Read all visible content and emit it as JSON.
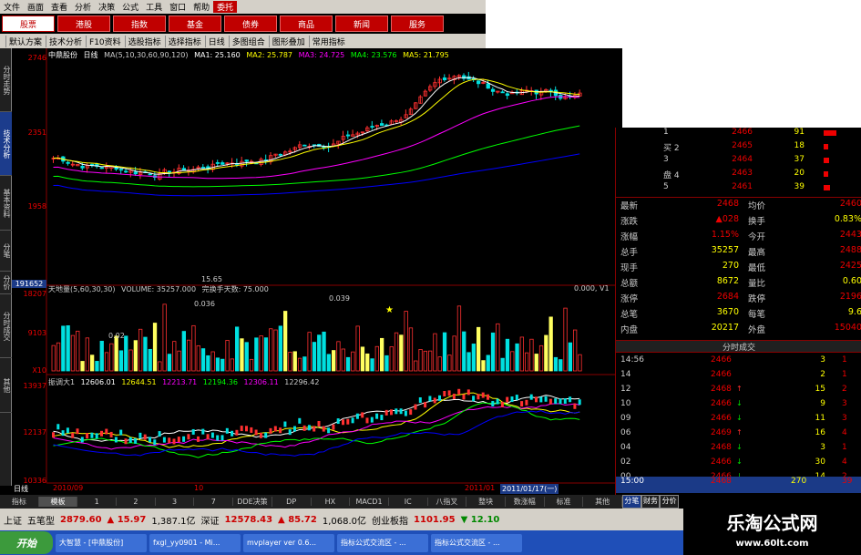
{
  "menu": [
    "文件",
    "画面",
    "查看",
    "分析",
    "决策",
    "公式",
    "工具",
    "窗口",
    "帮助",
    "委托"
  ],
  "nav": [
    "股票",
    "港股",
    "指数",
    "基金",
    "债券",
    "商品",
    "新闻",
    "服务"
  ],
  "toolbar": [
    "默认方案",
    "技术分析",
    "F10资料",
    "选股指标",
    "选择指标",
    "日线",
    "多图组合",
    "图形叠加",
    "常用指标"
  ],
  "sidetabs": [
    "分时走势",
    "技术分析",
    "基本资料",
    "分笔",
    "分价",
    "分时成交",
    "其他"
  ],
  "main_axis": {
    "top": "2746",
    "upper": "2351",
    "lower": "1958",
    "box": "191652"
  },
  "ma_legend": {
    "stock": "中鼎股份",
    "period": "日线",
    "params": "MA(5,10,30,60,90,120)",
    "ma1": "MA1: 25.160",
    "ma2": "MA2: 25.787",
    "ma3": "MA3: 24.725",
    "ma4": "MA4: 23.576",
    "ma5": "MA5: 21.795"
  },
  "min_label": "15.65",
  "vol_axis": {
    "top": "18207",
    "mid": "9103",
    "unit": "X10"
  },
  "vol_legend": {
    "name": "天地量(5,60,30,30)",
    "volume": "VOLUME: 35257.000",
    "days": "完换手天数: 75.000",
    "right": "0.000, V1"
  },
  "vol_marks": {
    "a": "0.039",
    "b": "0.036",
    "c": "0.02"
  },
  "ind_axis": {
    "top": "13937",
    "mid": "12137",
    "bottom": "10336"
  },
  "ind_legend": {
    "name": "振调大1",
    "v1": "12606.01",
    "v2": "12644.51",
    "v3": "12213.71",
    "v4": "12194.36",
    "v5": "12306.11",
    "v6": "12296.42"
  },
  "date_bar": {
    "period": "日线",
    "d1": "2010/09",
    "d2": "10",
    "d3": "2011/01",
    "cursor": "2011/01/17(一)"
  },
  "orderbook": [
    {
      "label": "1",
      "price": "2466",
      "vol": "91",
      "bar": 0.45
    },
    {
      "label": "买 2",
      "price": "2465",
      "vol": "18",
      "bar": 0.18
    },
    {
      "label": "3",
      "price": "2464",
      "vol": "37",
      "bar": 0.2
    },
    {
      "label": "盘 4",
      "price": "2463",
      "vol": "20",
      "bar": 0.18
    },
    {
      "label": "5",
      "price": "2461",
      "vol": "39",
      "bar": 0.22
    }
  ],
  "stats": [
    {
      "k": "最新",
      "v": "2468",
      "k2": "均价",
      "v2": "2460"
    },
    {
      "k": "涨跌",
      "v": "▲028",
      "k2": "换手",
      "v2": "0.83%"
    },
    {
      "k": "涨幅",
      "v": "1.15%",
      "k2": "今开",
      "v2": "2443"
    },
    {
      "k": "总手",
      "v": "35257",
      "k2": "最高",
      "v2": "2488"
    },
    {
      "k": "现手",
      "v": "270",
      "k2": "最低",
      "v2": "2425"
    },
    {
      "k": "总额",
      "v": "8672",
      "k2": "量比",
      "v2": "0.60"
    },
    {
      "k": "涨停",
      "v": "2684",
      "k2": "跌停",
      "v2": "2196"
    },
    {
      "k": "总笔",
      "v": "3670",
      "k2": "每笔",
      "v2": "9.6"
    },
    {
      "k": "内盘",
      "v": "20217",
      "k2": "外盘",
      "v2": "15040"
    }
  ],
  "trades_title": "分时成交",
  "trades": [
    {
      "t": "14:56",
      "p": "2466",
      "a": "",
      "v": "3",
      "n": "1"
    },
    {
      "t": "14",
      "p": "2466",
      "a": "",
      "v": "2",
      "n": "1"
    },
    {
      "t": "12",
      "p": "2468",
      "a": "↑",
      "v": "15",
      "n": "2"
    },
    {
      "t": "10",
      "p": "2466",
      "a": "↓",
      "v": "9",
      "n": "3"
    },
    {
      "t": "09",
      "p": "2466",
      "a": "↓",
      "v": "11",
      "n": "3"
    },
    {
      "t": "06",
      "p": "2469",
      "a": "↑",
      "v": "16",
      "n": "4"
    },
    {
      "t": "04",
      "p": "2468",
      "a": "↓",
      "v": "3",
      "n": "1"
    },
    {
      "t": "02",
      "p": "2466",
      "a": "↓",
      "v": "30",
      "n": "4"
    },
    {
      "t": "00",
      "p": "2466",
      "a": "↓",
      "v": "14",
      "n": "2"
    }
  ],
  "last_trade": {
    "t": "15:00",
    "p": "2468",
    "v": "270",
    "n": "39"
  },
  "bottom_tabs": [
    "指标",
    "模板",
    "1",
    "2",
    "3",
    "7",
    "DDE决策",
    "DP",
    "HX",
    "MACD1",
    "IC",
    "八指叉",
    "整块",
    "数涨幅",
    "标准",
    "其他"
  ],
  "right_tabs": [
    "分笔",
    "财务",
    "分价"
  ],
  "ticker": [
    {
      "t": "五笔型",
      "c": ""
    },
    {
      "t": "2879.60",
      "c": "r"
    },
    {
      "t": "▲ 15.97",
      "c": "r"
    },
    {
      "t": "1,387.1亿",
      "c": ""
    },
    {
      "t": "深证",
      "c": ""
    },
    {
      "t": "12578.43",
      "c": "r"
    },
    {
      "t": "▲ 85.72",
      "c": "r"
    },
    {
      "t": "1,068.0亿",
      "c": ""
    },
    {
      "t": "创业板指",
      "c": ""
    },
    {
      "t": "1101.95",
      "c": "r"
    },
    {
      "t": "▼ 12.10",
      "c": "g"
    }
  ],
  "ticker_prefix": "上证",
  "start_label": "开始",
  "tasks": [
    "大智慧 - [中鼎股份]",
    "fxgl_yy0901 - Mi...",
    "mvplayer ver 0.6...",
    "指标公式交流区 - ...",
    "指标公式交流区 - ..."
  ],
  "brand": {
    "name": "乐淘公式网",
    "url": "www.60lt.com"
  },
  "colors": {
    "up": "#ff3030",
    "down": "#00e0e0",
    "vol": "#ffff60",
    "ma1": "#ffffff",
    "ma2": "#ffff00",
    "ma3": "#ff00ff",
    "ma4": "#00ff00",
    "ma5": "#ffff00",
    "ma6": "#0000ff"
  }
}
